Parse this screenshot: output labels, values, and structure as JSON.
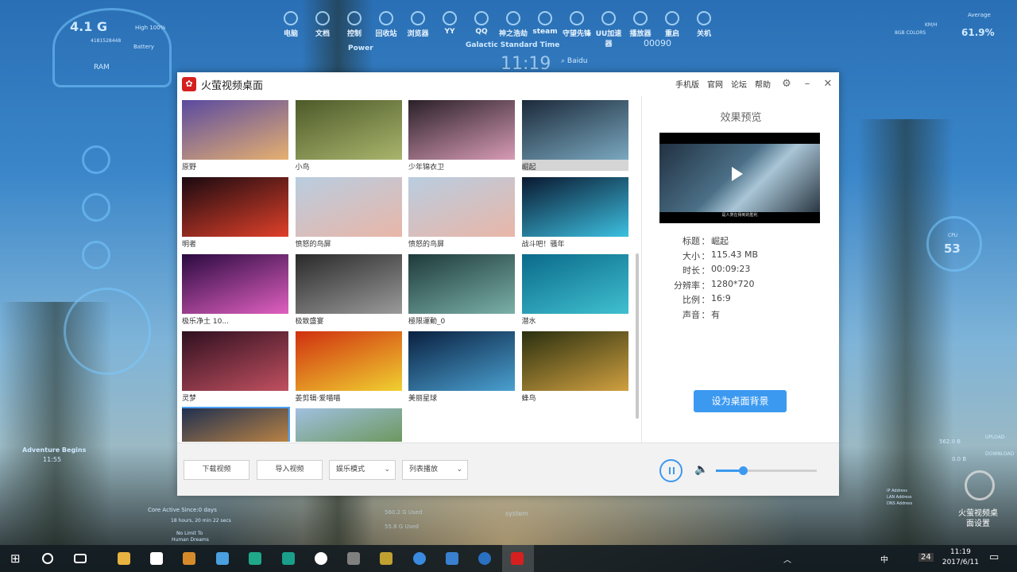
{
  "desktop": {
    "ram": "4.1 G",
    "ram_sub": "4181528448",
    "ram_label": "RAM",
    "battery_high": "High 100%",
    "battery_label": "Battery",
    "power_label": "Power",
    "galactic": "Galactic Standard Time",
    "hud_time": "11:19",
    "search": "Baidu",
    "counter": "00090",
    "kmh": "KM/H",
    "color_depth": "8GB COLORS",
    "average": "Average",
    "cpu_avg": "61.9%",
    "cpu_label": "CPU",
    "cpu_value": "53",
    "adventure": "Adventure Begins",
    "adventure_time": "11:55",
    "core_active": "Core Active Since:0 days",
    "core_time": "18 hours, 20 min 22 secs",
    "no_limit": "No Limit To",
    "human_dreams": "Human Dreams",
    "used_1": "560.2 G Used",
    "used_2": "55.8 G Used",
    "system": "system",
    "disk_1": "562.0 B",
    "disk_2": "0.0 B",
    "upload": "UPLOAD",
    "download": "DOWNLOAD",
    "ip_labels": [
      "IP Address",
      "LAN Address",
      "DNS Address"
    ],
    "brand_line1": "火萤视频桌",
    "brand_line2": "面设置",
    "topbar_items": [
      "电脑",
      "文档",
      "控制",
      "回收站",
      "浏览器",
      "YY",
      "QQ",
      "神之浩劫",
      "steam",
      "守望先锋",
      "UU加速器",
      "播放器",
      "重启",
      "关机"
    ]
  },
  "window": {
    "title": "火萤视频桌面",
    "links": [
      "手机版",
      "官网",
      "论坛",
      "帮助"
    ],
    "settings_icon": "gear-icon",
    "min_icon": "minimize-icon",
    "close_icon": "close-icon"
  },
  "gallery": [
    {
      "label": "原野",
      "c1": "#5a4aa0",
      "c2": "#e6b070"
    },
    {
      "label": "小鸟",
      "c1": "#4d5a2a",
      "c2": "#a9b56c"
    },
    {
      "label": "少年锦衣卫",
      "c1": "#2a2028",
      "c2": "#d79bb5"
    },
    {
      "label": "崛起",
      "c1": "#1c2a3a",
      "c2": "#7aa8c0"
    },
    {
      "label": "明者",
      "c1": "#1a0a10",
      "c2": "#e0402a"
    },
    {
      "label": "愤怒的鸟屏",
      "c1": "#b9cde0",
      "c2": "#e9b6a8"
    },
    {
      "label": "愤怒的鸟屏",
      "c1": "#b9cde0",
      "c2": "#e9b6a8"
    },
    {
      "label": "战斗吧！骚年",
      "c1": "#0a1830",
      "c2": "#3cc0e0"
    },
    {
      "label": "极乐净土 10...",
      "c1": "#2a0a40",
      "c2": "#e060c0"
    },
    {
      "label": "极致盛宴",
      "c1": "#2a2a2a",
      "c2": "#9a9a9a"
    },
    {
      "label": "極限運動_0",
      "c1": "#1e3a3a",
      "c2": "#7ab0a8"
    },
    {
      "label": "潜水",
      "c1": "#0a6a8a",
      "c2": "#40c0d0"
    },
    {
      "label": "灵梦",
      "c1": "#301020",
      "c2": "#c05060"
    },
    {
      "label": "姜剪辑·爱喵喵",
      "c1": "#d03010",
      "c2": "#f0d030"
    },
    {
      "label": "美丽星球",
      "c1": "#0a2040",
      "c2": "#4aa0d0"
    },
    {
      "label": "蜂鸟",
      "c1": "#2a3010",
      "c2": "#d0a040"
    },
    {
      "label": "",
      "c1": "#203050",
      "c2": "#f0a040"
    },
    {
      "label": "",
      "c1": "#a0c0e0",
      "c2": "#5a8a30"
    }
  ],
  "preview": {
    "heading": "效果预览",
    "caption": "是人类在得到的胜利",
    "fields": [
      {
        "key": "标题",
        "value": "崛起"
      },
      {
        "key": "大小",
        "value": "115.43 MB"
      },
      {
        "key": "时长",
        "value": "00:09:23"
      },
      {
        "key": "分辨率",
        "value": "1280*720"
      },
      {
        "key": "比例",
        "value": "16:9"
      },
      {
        "key": "声音",
        "value": "有"
      }
    ],
    "set_button": "设为桌面背景"
  },
  "bottom": {
    "download_btn": "下载视频",
    "import_btn": "导入视频",
    "mode_select": "娱乐模式",
    "play_select": "列表播放",
    "volume": 0.27
  },
  "taskbar": {
    "time": "11:19",
    "date": "2017/6/11",
    "ime": "中",
    "badge": "24",
    "accent": "#3c99f0"
  }
}
